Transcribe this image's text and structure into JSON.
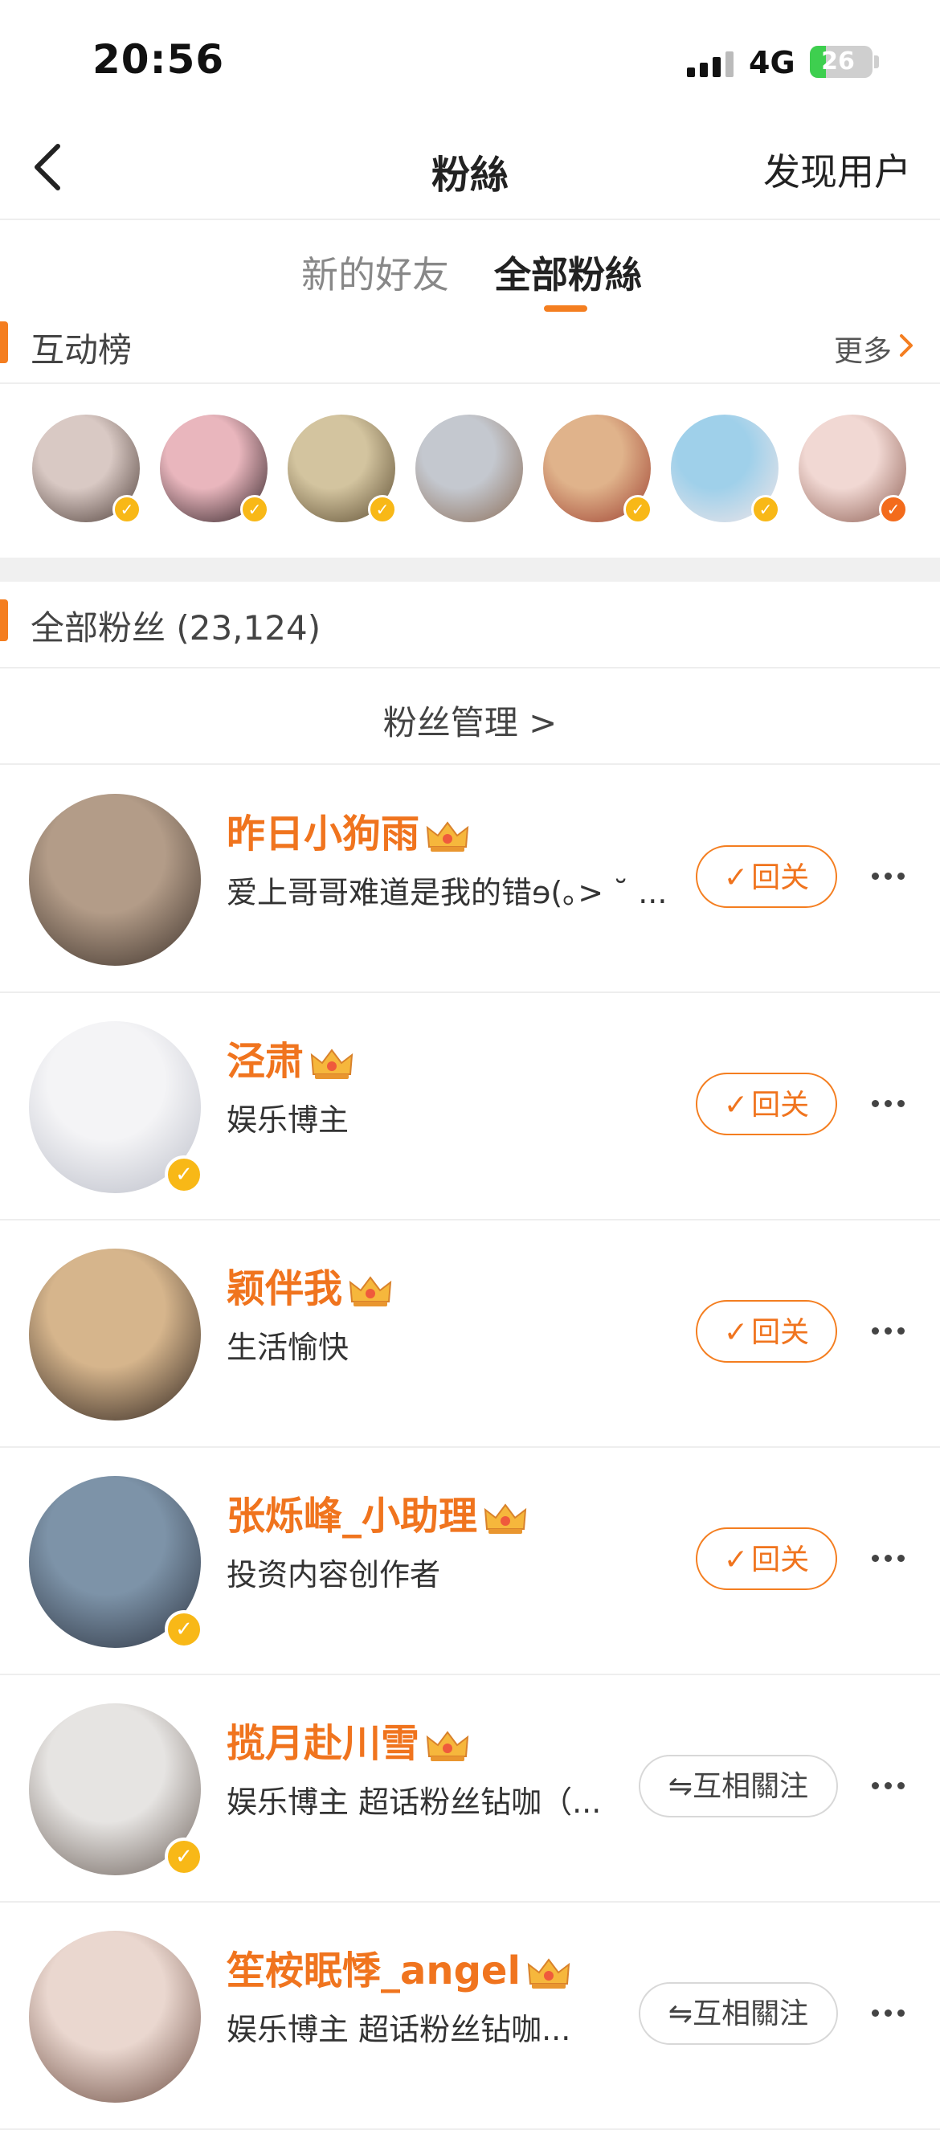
{
  "status_bar": {
    "time": "20:56",
    "network": "4G",
    "battery": "26",
    "battery_level": 0.26
  },
  "nav": {
    "title": "粉絲",
    "discover": "发现用户"
  },
  "tabs": {
    "new_friends": "新的好友",
    "all_fans": "全部粉絲"
  },
  "interaction_board": {
    "title": "互动榜",
    "more": "更多",
    "avatars": [
      {
        "colors": [
          "#d9c9c4",
          "#4a3a34"
        ],
        "badge": "yellow"
      },
      {
        "colors": [
          "#e9b6bd",
          "#2b1e22"
        ],
        "badge": "yellow"
      },
      {
        "colors": [
          "#d3c49f",
          "#5a4a2f"
        ],
        "badge": "yellow"
      },
      {
        "colors": [
          "#c4c8cf",
          "#8a6b55"
        ],
        "badge": "none"
      },
      {
        "colors": [
          "#e0b38b",
          "#9c3d2e"
        ],
        "badge": "yellow"
      },
      {
        "colors": [
          "#9fd0ea",
          "#f3e6e8"
        ],
        "badge": "yellow"
      },
      {
        "colors": [
          "#f1d8d3",
          "#8a5a4e"
        ],
        "badge": "orange"
      }
    ]
  },
  "all_fans": {
    "title": "全部粉丝 (23,124)",
    "manage": "粉丝管理  >"
  },
  "fans": [
    {
      "name": "昨日小狗雨",
      "desc": "爱上哥哥难道是我的错ɘ(｡> ˘ ...",
      "button": "回关",
      "button_type": "follow",
      "verified": false,
      "colors": [
        "#b39c88",
        "#3a2f28"
      ]
    },
    {
      "name": "泾肃",
      "desc": "娱乐博主",
      "button": "回关",
      "button_type": "follow",
      "verified": true,
      "colors": [
        "#f4f4f6",
        "#b9bcc7"
      ]
    },
    {
      "name": "颖伴我",
      "desc": "生活愉快",
      "button": "回关",
      "button_type": "follow",
      "verified": false,
      "colors": [
        "#d6b58c",
        "#2a201c"
      ]
    },
    {
      "name": "张烁峰_小助理",
      "desc": "投资内容创作者",
      "button": "回关",
      "button_type": "follow",
      "verified": true,
      "colors": [
        "#7d93a8",
        "#2c3340"
      ]
    },
    {
      "name": "揽月赴川雪",
      "desc": "娱乐博主 超话粉丝钻咖（...",
      "button": "互相關注",
      "button_type": "mutual",
      "verified": true,
      "colors": [
        "#e6e4e2",
        "#6b5f58"
      ]
    },
    {
      "name": "笙桉眠悸_angel",
      "desc": "娱乐博主 超话粉丝钻咖...",
      "button": "互相關注",
      "button_type": "mutual",
      "verified": false,
      "colors": [
        "#ead7cf",
        "#6a4a3f"
      ]
    }
  ],
  "icons": {
    "back": "chevron-left-icon",
    "more_arrow": "chevron-right-icon",
    "check": "check-icon",
    "mutual": "swap-arrows-icon",
    "more_options": "ellipsis-icon"
  },
  "colors": {
    "accent": "#f47e20",
    "name": "#f0741e",
    "verified": "#f8b817"
  }
}
